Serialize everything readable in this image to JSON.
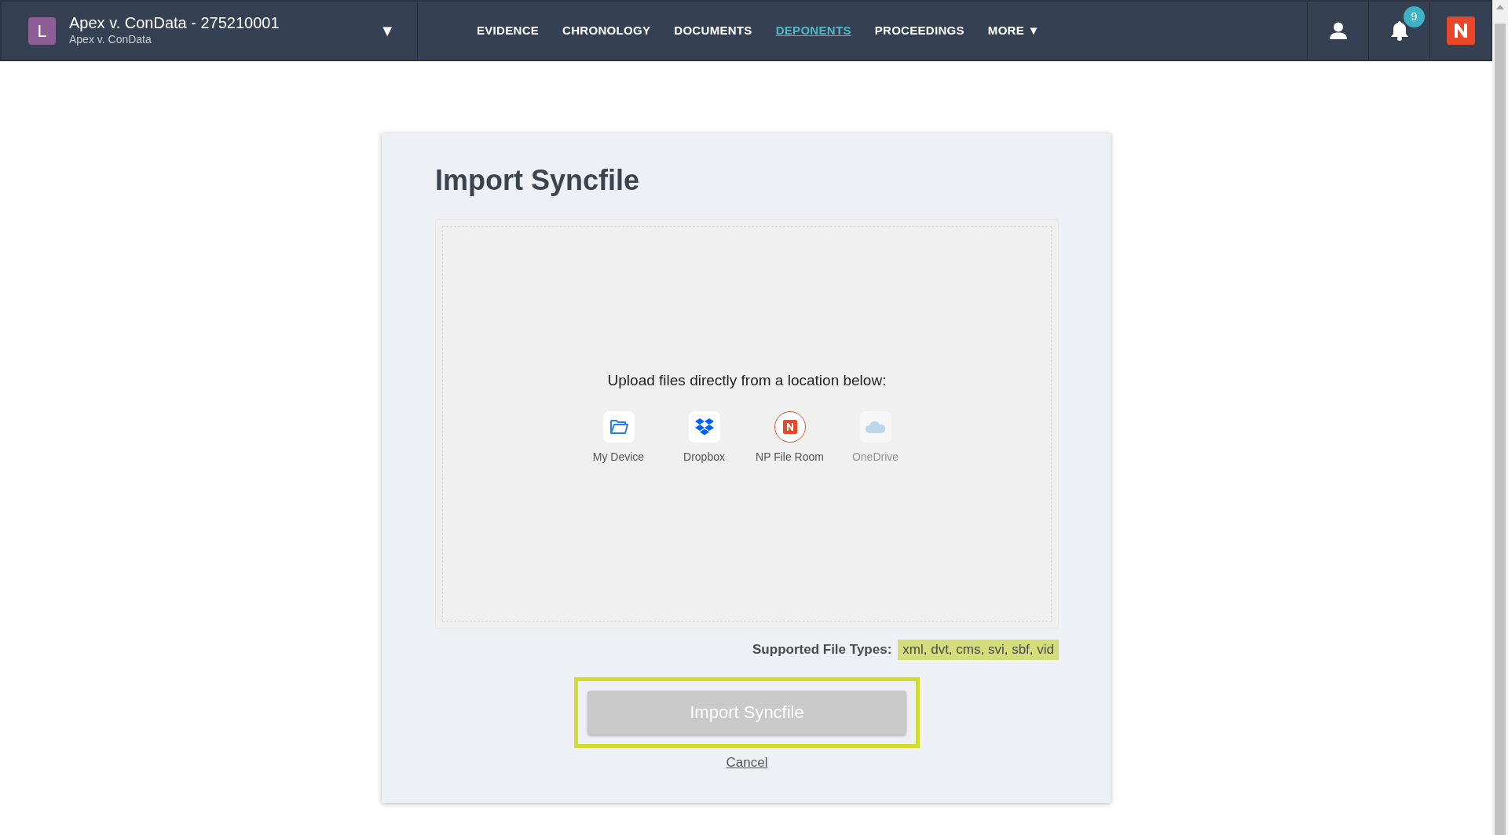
{
  "header": {
    "avatar_letter": "L",
    "title": "Apex v. ConData - 275210001",
    "subtitle": "Apex v. ConData",
    "dropdown": "▼"
  },
  "tabs": [
    {
      "label": "EVIDENCE",
      "selected": false
    },
    {
      "label": "CHRONOLOGY",
      "selected": false
    },
    {
      "label": "DOCUMENTS",
      "selected": false
    },
    {
      "label": "DEPONENTS",
      "selected": true
    },
    {
      "label": "PROCEEDINGS",
      "selected": false
    },
    {
      "label": "MORE ▼",
      "selected": false
    }
  ],
  "notifications": {
    "count": "9"
  },
  "dialog": {
    "title": "Import Syncfile",
    "upload_prompt": "Upload files directly from a location below:",
    "sources": [
      {
        "kind": "device",
        "label": "My Device",
        "disabled": false
      },
      {
        "kind": "dropbox",
        "label": "Dropbox",
        "disabled": false
      },
      {
        "kind": "fileroom",
        "label": "NP File Room",
        "disabled": false
      },
      {
        "kind": "onedrive",
        "label": "OneDrive",
        "disabled": true
      }
    ],
    "supported_label": "Supported File Types:",
    "supported_types": "xml, dvt, cms, svi, sbf, vid",
    "import_button": {
      "label": "Import Syncfile",
      "disabled": true
    },
    "cancel": "Cancel"
  }
}
